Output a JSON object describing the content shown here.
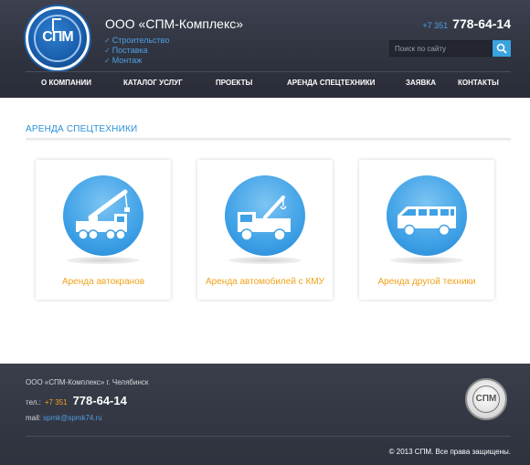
{
  "header": {
    "logo_icon": "spm-logo",
    "logo_text": "СПМ",
    "company_name": "ООО «СПМ-Комплекс»",
    "tagline": [
      "Строительство",
      "Поставка",
      "Монтаж"
    ],
    "phone_code": "+7 351",
    "phone_number": "778-64-14",
    "search_placeholder": "Поиск по сайту",
    "search_icon": "search-icon"
  },
  "nav": {
    "items": [
      "О КОМПАНИИ",
      "КАТАЛОГ УСЛУГ",
      "ПРОЕКТЫ",
      "АРЕНДА СПЕЦТЕХНИКИ",
      "ЗАЯВКА",
      "КОНТАКТЫ"
    ]
  },
  "main": {
    "section_title": "АРЕНДА СПЕЦТЕХНИКИ",
    "cards": [
      {
        "label": "Аренда автокранов",
        "icon": "crane-truck-icon"
      },
      {
        "label": "Аренда автомобилей с КМУ",
        "icon": "tow-truck-icon"
      },
      {
        "label": "Аренда другой техники",
        "icon": "van-icon"
      }
    ]
  },
  "footer": {
    "company": "ООО «СПМ-Комплекс» г. Челябинск",
    "phone_label": "тел.:",
    "phone_code": "+7 351",
    "phone_number": "778-64-14",
    "mail_label": "mail:",
    "mail_address": "spmk@spmk74.ru",
    "logo_text": "СПМ",
    "copyright": "© 2013 СПМ. Все права защищены."
  },
  "colors": {
    "accent_blue": "#2a8fd8",
    "accent_orange": "#f0a21b",
    "header_bg": "#353946"
  }
}
